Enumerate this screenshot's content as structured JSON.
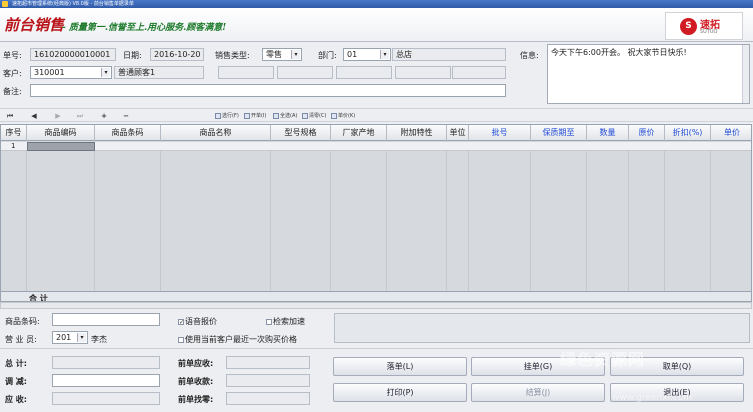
{
  "window": {
    "title": "速拓超市管理系统(经典版) V8.0版 - 前台销售单据录单"
  },
  "banner": {
    "logo": "前台销售",
    "slogan": "- 质量第一.信誉至上.用心服务.顾客满意!",
    "brand_name": "速拓",
    "brand_sub": "SUTUO"
  },
  "header": {
    "doc_no_label": "单号:",
    "doc_no": "161020000010001",
    "date_label": "日期:",
    "date": "2016-10-20",
    "sale_type_label": "销售类型:",
    "sale_type": "零售",
    "dept_label": "部门:",
    "dept_code": "01",
    "dept_name": "总店",
    "customer_label": "客户:",
    "customer_code": "310001",
    "customer_name": "普通顾客1",
    "remark_label": "备注:",
    "remark": "",
    "info_label": "信息:",
    "info_text": "今天下午6:00开会。 祝大家节日快乐!"
  },
  "toolbar": {
    "nav_first": "⏮",
    "nav_prev": "◀",
    "nav_next": "▶",
    "nav_last": "⏭",
    "add": "+",
    "remove": "−",
    "btn1": "选行(F)",
    "btn2": "开单(I)",
    "btn3": "全选(A)",
    "btn4": "清零(C)",
    "btn5": "单价(K)"
  },
  "grid": {
    "columns": [
      "序号",
      "商品编码",
      "商品条码",
      "商品名称",
      "型号规格",
      "厂家产地",
      "附加特性",
      "单位",
      "批号",
      "保质期至",
      "数量",
      "原价",
      "折扣(%)",
      "单价"
    ],
    "rows": [
      [
        "1"
      ]
    ],
    "total_label": "合  计"
  },
  "bottom": {
    "barcode_label": "商品条码:",
    "barcode": "",
    "voice_label": "语音报价",
    "search_label": "检索加速",
    "salesman_label": "营 业 员:",
    "salesman_code": "201",
    "salesman_name": "李杰",
    "last_price_label": "使用当前客户最近一次购买价格",
    "total_label": "总    计:",
    "discount_label": "调    减:",
    "receivable_label": "应    收:",
    "prev_due_label": "前单应收:",
    "prev_received_label": "前单收款:",
    "prev_change_label": "前单找零:",
    "btn_save": "落单(L)",
    "btn_hold": "挂单(G)",
    "btn_retrieve": "取单(Q)",
    "btn_print": "打印(P)",
    "btn_checkout": "结算(J)",
    "btn_exit": "退出(E)"
  },
  "watermark": {
    "text": "绿色资源网",
    "url": "www.greenxf.com"
  }
}
